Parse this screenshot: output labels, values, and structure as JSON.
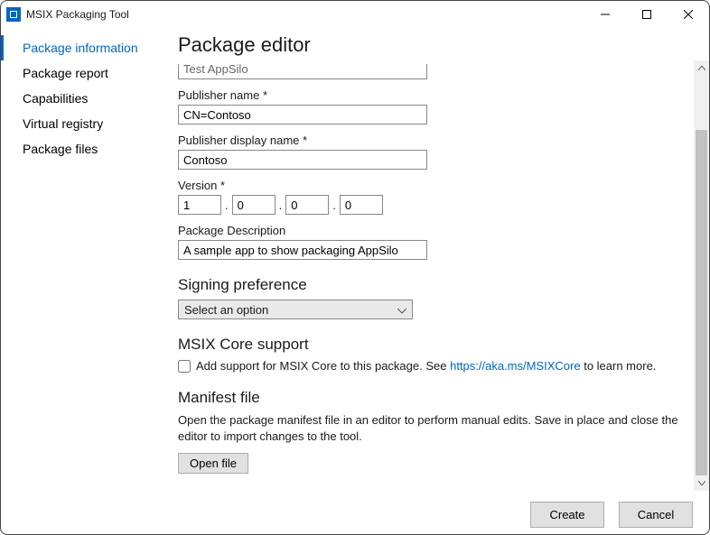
{
  "window": {
    "title": "MSIX Packaging Tool"
  },
  "sidebar": {
    "items": [
      {
        "label": "Package information",
        "active": true
      },
      {
        "label": "Package report"
      },
      {
        "label": "Capabilities"
      },
      {
        "label": "Virtual registry"
      },
      {
        "label": "Package files"
      }
    ]
  },
  "page": {
    "title": "Package editor",
    "truncated_field_value": "Test AppSilo",
    "publisher_name_label": "Publisher name *",
    "publisher_name_value": "CN=Contoso",
    "publisher_display_label": "Publisher display name *",
    "publisher_display_value": "Contoso",
    "version_label": "Version *",
    "version": {
      "major": "1",
      "minor": "0",
      "build": "0",
      "rev": "0"
    },
    "description_label": "Package Description",
    "description_value": "A sample app to show packaging AppSilo",
    "signing_heading": "Signing preference",
    "signing_selected": "Select an option",
    "msix_core_heading": "MSIX Core support",
    "msix_core_prefix": "Add support for MSIX Core to this package. See ",
    "msix_core_link": "https://aka.ms/MSIXCore",
    "msix_core_suffix": " to learn more.",
    "manifest_heading": "Manifest file",
    "manifest_text": "Open the package manifest file in an editor to perform manual edits. Save in place and close the editor to import changes to the tool.",
    "open_file_label": "Open file"
  },
  "footer": {
    "create_label": "Create",
    "cancel_label": "Cancel"
  }
}
